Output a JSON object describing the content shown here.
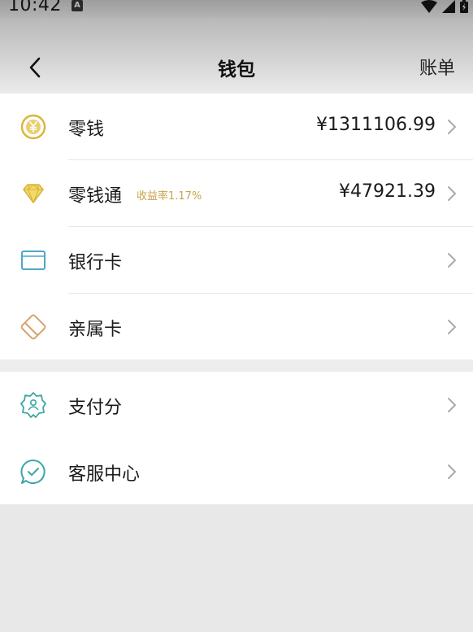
{
  "status_bar": {
    "time": "10:42",
    "notification_icon": "a-square-icon",
    "icons": [
      "wifi-icon",
      "signal-icon",
      "battery-icon"
    ]
  },
  "header": {
    "title": "钱包",
    "right_link": "账单",
    "back_icon": "chevron-left-icon"
  },
  "colors": {
    "gold": "#d9b43c",
    "rate_gold": "#c9a24a",
    "teal": "#3ba6a6",
    "bank_blue": "#4ea7c8",
    "tan": "#d7a36e"
  },
  "wallet_items": [
    {
      "label": "零钱",
      "value": "¥1311106.99",
      "icon": "yuan-coin-icon"
    },
    {
      "label": "零钱通",
      "rate": "收益率1.17%",
      "value": "¥47921.39",
      "icon": "diamond-icon"
    },
    {
      "label": "银行卡",
      "icon": "bank-card-icon"
    },
    {
      "label": "亲属卡",
      "icon": "family-card-icon"
    }
  ],
  "service_items": [
    {
      "label": "支付分",
      "icon": "pay-score-badge-icon"
    },
    {
      "label": "客服中心",
      "icon": "customer-service-icon"
    }
  ]
}
